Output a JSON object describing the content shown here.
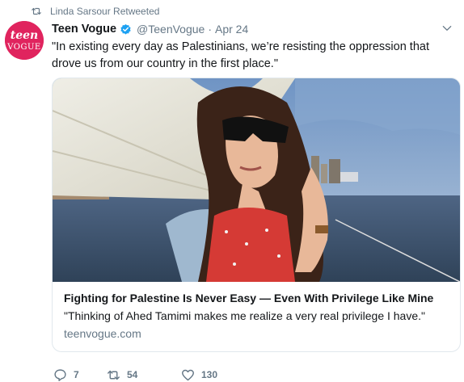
{
  "retweet_context": {
    "text": "Linda Sarsour Retweeted"
  },
  "tweet": {
    "author_name": "Teen Vogue",
    "handle": "@TeenVogue",
    "separator": "·",
    "date": "Apr 24",
    "text": "\"In existing every day as Palestinians, we’re resisting the oppression that drove us from our country in the first place.\"",
    "avatar_logo": "teen VOGUE"
  },
  "card": {
    "title": "Fighting for Palestine Is Never Easy — Even With Privilege Like Mine",
    "description": "\"Thinking of Ahed Tamimi makes me realize a very real privilege I have.\"",
    "domain": "teenvogue.com"
  },
  "actions": {
    "reply_count": "7",
    "retweet_count": "54",
    "like_count": "130"
  },
  "colors": {
    "meta_gray": "#657786",
    "verified_blue": "#1da1f2",
    "avatar_bg": "#e0245e"
  },
  "icons": [
    "retweet-icon",
    "verified-badge-icon",
    "chevron-down-icon",
    "reply-icon",
    "retweet-icon",
    "heart-icon"
  ]
}
